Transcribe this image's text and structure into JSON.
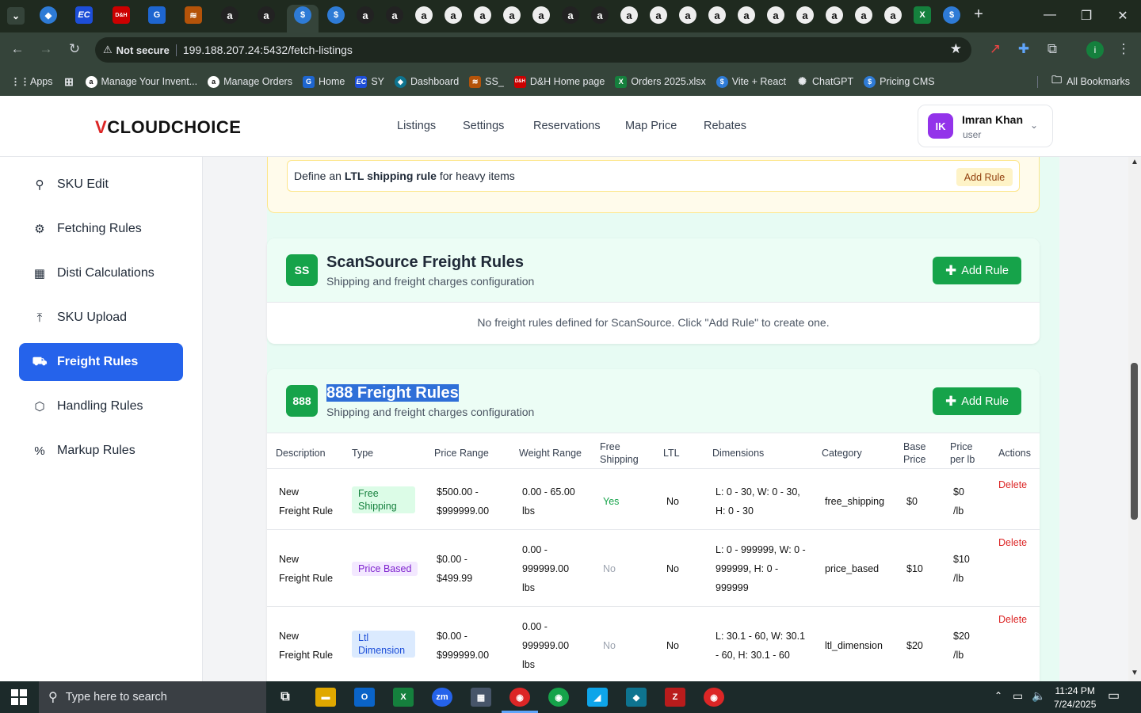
{
  "browser": {
    "url": "199.188.207.24:5432/fetch-listings",
    "security": "Not secure",
    "bookmarks": [
      "Apps",
      "Manage Your Invent...",
      "Manage Orders",
      "Home",
      "SY",
      "Dashboard",
      "SS_",
      "D&H Home page",
      "Orders 2025.xlsx",
      "Vite + React",
      "ChatGPT",
      "Pricing CMS"
    ],
    "all_bookmarks": "All Bookmarks",
    "tab_icons": [
      "EC",
      "D&H"
    ]
  },
  "header": {
    "logo_v": "V",
    "logo_text": "CLOUDCHOICE",
    "nav": [
      "Listings",
      "Settings",
      "Reservations",
      "Map Price",
      "Rebates"
    ],
    "user_name": "Imran Khan",
    "user_role": "user",
    "user_initials": "IK"
  },
  "sidebar": {
    "items": [
      {
        "label": "SKU Edit",
        "icon": "search-icon"
      },
      {
        "label": "Fetching Rules",
        "icon": "gear-icon"
      },
      {
        "label": "Disti Calculations",
        "icon": "calculator-icon"
      },
      {
        "label": "SKU Upload",
        "icon": "upload-icon"
      },
      {
        "label": "Freight Rules",
        "icon": "truck-icon"
      },
      {
        "label": "Handling Rules",
        "icon": "box-icon"
      },
      {
        "label": "Markup Rules",
        "icon": "percent-icon"
      }
    ],
    "active_index": 4
  },
  "ltl": {
    "prefix": "Define an ",
    "bold": "LTL shipping rule",
    "suffix": " for heavy items",
    "button": "Add Rule"
  },
  "scansource": {
    "badge": "SS",
    "title": "ScanSource Freight Rules",
    "subtitle": "Shipping and freight charges configuration",
    "add": "Add Rule",
    "empty": "No freight rules defined for ScanSource. Click \"Add Rule\" to create one."
  },
  "r888": {
    "badge": "888",
    "title": "888 Freight Rules",
    "subtitle": "Shipping and freight charges configuration",
    "add": "Add Rule",
    "columns": [
      "Description",
      "Type",
      "Price Range",
      "Weight Range",
      "Free Shipping",
      "LTL",
      "Dimensions",
      "Category",
      "Base Price",
      "Price per lb",
      "Actions"
    ],
    "col_free_1": "Free",
    "col_free_2": "Shipping",
    "col_base_1": "Base",
    "col_base_2": "Price",
    "col_ppl_1": "Price",
    "col_ppl_2": "per lb",
    "rows": [
      {
        "desc1": "New",
        "desc2": "Freight Rule",
        "type1": "Free",
        "type2": "Shipping",
        "price1": "$500.00 -",
        "price2": "$999999.00",
        "w1": "0.00 - 65.00",
        "w2": "lbs",
        "w3": "",
        "free": "Yes",
        "ltl": "No",
        "dim1": "L: 0 - 30, W: 0 - 30,",
        "dim2": "H: 0 - 30",
        "dim3": "",
        "cat": "free_shipping",
        "base": "$0",
        "ppl1": "$0",
        "ppl2": "/lb",
        "action": "Delete"
      },
      {
        "desc1": "New",
        "desc2": "Freight Rule",
        "type1": "Price Based",
        "type2": "",
        "price1": "$0.00 -",
        "price2": "$499.99",
        "w1": "0.00 -",
        "w2": "999999.00",
        "w3": "lbs",
        "free": "No",
        "ltl": "No",
        "dim1": "L: 0 - 999999, W: 0 -",
        "dim2": "999999, H: 0 -",
        "dim3": "999999",
        "cat": "price_based",
        "base": "$10",
        "ppl1": "$10",
        "ppl2": "/lb",
        "action": "Delete"
      },
      {
        "desc1": "New",
        "desc2": "Freight Rule",
        "type1": "Ltl",
        "type2": "Dimension",
        "price1": "$0.00 -",
        "price2": "$999999.00",
        "w1": "0.00 -",
        "w2": "999999.00",
        "w3": "lbs",
        "free": "No",
        "ltl": "No",
        "dim1": "L: 30.1 - 60, W: 30.1",
        "dim2": "- 60, H: 30.1 - 60",
        "dim3": "",
        "cat": "ltl_dimension",
        "base": "$20",
        "ppl1": "$20",
        "ppl2": "/lb",
        "action": "Delete"
      }
    ]
  },
  "taskbar": {
    "search_placeholder": "Type here to search",
    "time": "11:24 PM",
    "date": "7/24/2025"
  },
  "colors": {
    "primary": "#2563eb",
    "green": "#16a34a",
    "danger": "#dc2626",
    "ltl_bg": "#fffbeb"
  }
}
